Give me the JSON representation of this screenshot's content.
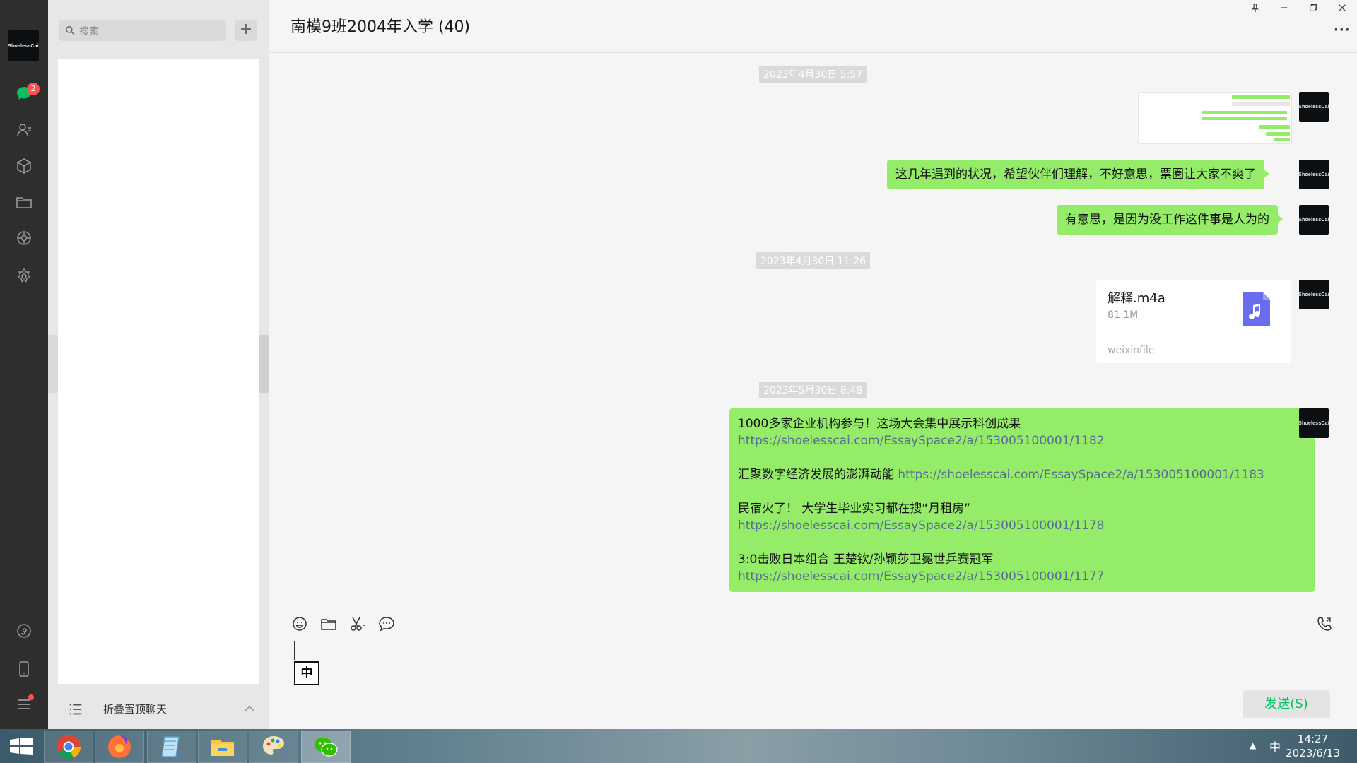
{
  "sidebar": {
    "avatar_text": "ShoelessCai",
    "chat_badge": "2"
  },
  "list": {
    "search_placeholder": "搜索",
    "add_label": "+",
    "collapse_label": "折叠置顶聊天"
  },
  "chat": {
    "title": "南模9班2004年入学 (40)",
    "more_label": "···",
    "messages": {
      "ts1": "2023年4月30日 5:57",
      "m2": "这几年遇到的状况，希望伙伴们理解，不好意思，票圈让大家不爽了",
      "m3": "有意思，是因为没工作这件事是人为的",
      "ts2": "2023年4月30日 11:26",
      "file": {
        "name": "解释.m4a",
        "size": "81.1M",
        "source": "weixinfile"
      },
      "ts3": "2023年5月30日 8:48",
      "long": [
        {
          "text": "1000多家企业机构参与！这场大会集中展示科创成果 ",
          "link": "https://shoelesscai.com/EssaySpace2/a/153005100001/1182"
        },
        {
          "text": "汇聚数字经济发展的澎湃动能 ",
          "link": "https://shoelesscai.com/EssaySpace2/a/153005100001/1183"
        },
        {
          "text": "民宿火了！ 大学生毕业实习都在搜“月租房” ",
          "link": "https://shoelesscai.com/EssaySpace2/a/153005100001/1178"
        },
        {
          "text": "3:0击败日本组合 王楚钦/孙颖莎卫冕世乒赛冠军 ",
          "link": "https://shoelesscai.com/EssaySpace2/a/153005100001/1177"
        }
      ]
    }
  },
  "input": {
    "ime_indicator": "中",
    "send_label": "发送(S)"
  },
  "taskbar": {
    "tray_ime": "中",
    "tray_up": "▲",
    "time": "14:27",
    "date": "2023/6/13"
  },
  "colors": {
    "bubble": "#95ec69",
    "link": "#576b95",
    "send_text": "#07c160",
    "badge": "#fa5151"
  }
}
